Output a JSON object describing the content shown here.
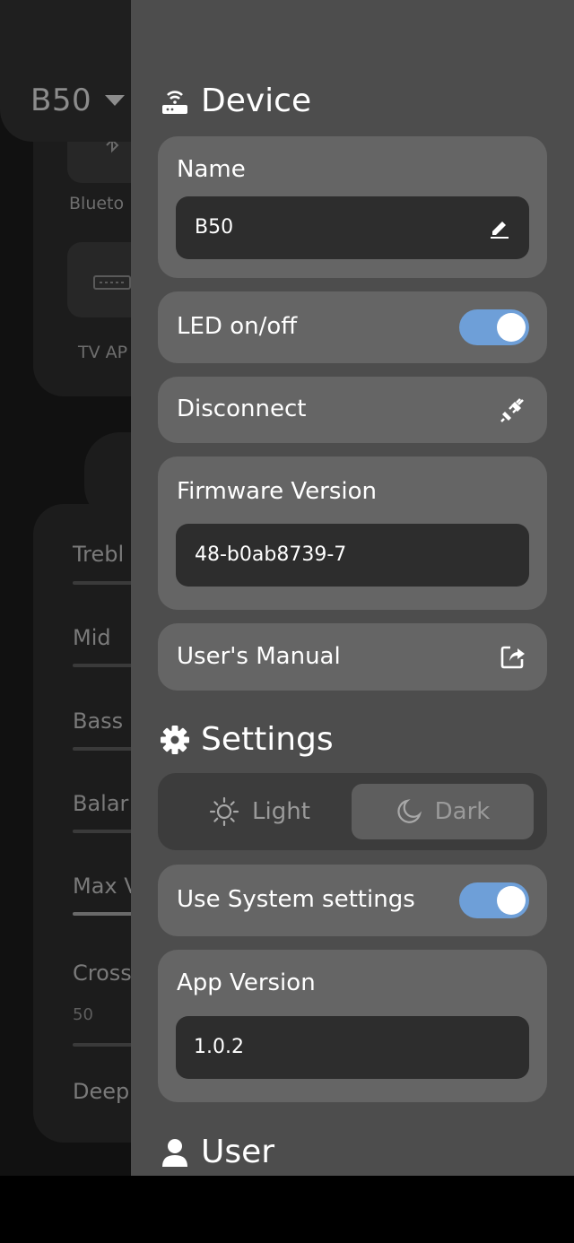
{
  "background": {
    "device_name": "B50",
    "sources": [
      "Blueto",
      "TV AP"
    ],
    "eq_labels": [
      "Trebl",
      "Mid",
      "Bass",
      "Balar",
      "Max V",
      "Cross",
      "Deep"
    ],
    "crossover_value": "50"
  },
  "device": {
    "title": "Device",
    "name_label": "Name",
    "name_value": "B50",
    "led_label": "LED on/off",
    "led_on": true,
    "disconnect_label": "Disconnect",
    "firmware_label": "Firmware Version",
    "firmware_value": "48-b0ab8739-7",
    "manual_label": "User's Manual"
  },
  "settings": {
    "title": "Settings",
    "theme_light": "Light",
    "theme_dark": "Dark",
    "theme_selected": "Dark",
    "system_label": "Use System settings",
    "system_on": true,
    "app_version_label": "App Version",
    "app_version_value": "1.0.2"
  },
  "user": {
    "title": "User"
  },
  "colors": {
    "toggle_on": "#6e9fd8",
    "drawer_bg": "#4d4d4d",
    "card_bg": "#656565",
    "field_bg": "#2d2d2d"
  }
}
